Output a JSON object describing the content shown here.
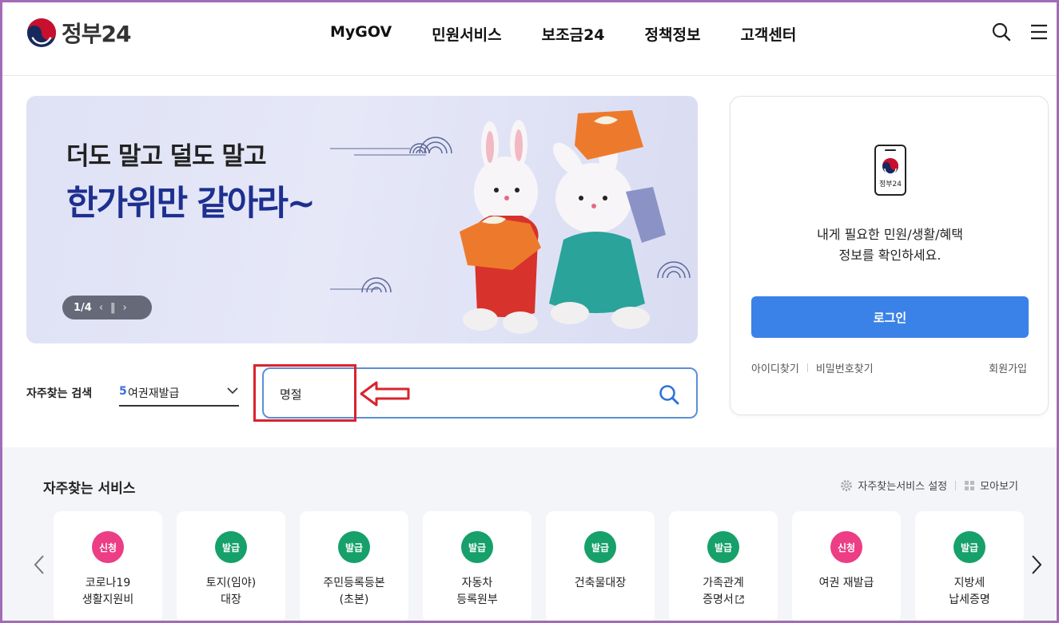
{
  "header": {
    "logo_text": "정부24",
    "nav": [
      "MyGOV",
      "민원서비스",
      "보조금24",
      "정책정보",
      "고객센터"
    ]
  },
  "banner": {
    "line1": "더도 말고 덜도 말고",
    "line2": "한가위만 같아라~",
    "page_indicator": "1/4"
  },
  "login": {
    "brand": "정부24",
    "message_line1": "내게 필요한 민원/생활/혜택",
    "message_line2": "정보를 확인하세요.",
    "login_button": "로그인",
    "find_id": "아이디찾기",
    "find_password": "비밀번호찾기",
    "signup": "회원가입"
  },
  "search": {
    "label": "자주찾는 검색",
    "selected_rank": "5",
    "selected_text": "여권재발급",
    "input_value": "명절"
  },
  "services": {
    "title": "자주찾는 서비스",
    "settings": "자주찾는서비스 설정",
    "view_all": "모아보기",
    "items": [
      {
        "badge": "신청",
        "type": "apply",
        "name": "코로나19\n생활지원비"
      },
      {
        "badge": "발급",
        "type": "issue",
        "name": "토지(임야)\n대장"
      },
      {
        "badge": "발급",
        "type": "issue",
        "name": "주민등록등본\n(초본)"
      },
      {
        "badge": "발급",
        "type": "issue",
        "name": "자동차\n등록원부"
      },
      {
        "badge": "발급",
        "type": "issue",
        "name": "건축물대장"
      },
      {
        "badge": "발급",
        "type": "issue",
        "name": "가족관계\n증명서"
      },
      {
        "badge": "신청",
        "type": "apply",
        "name": "여권 재발급"
      },
      {
        "badge": "발급",
        "type": "issue",
        "name": "지방세\n납세증명"
      }
    ]
  },
  "colors": {
    "accent": "#3b82e8",
    "apply_badge": "#ec3d85",
    "issue_badge": "#16a06a",
    "banner_title": "#1d2f8f",
    "highlight": "#d9232e"
  }
}
